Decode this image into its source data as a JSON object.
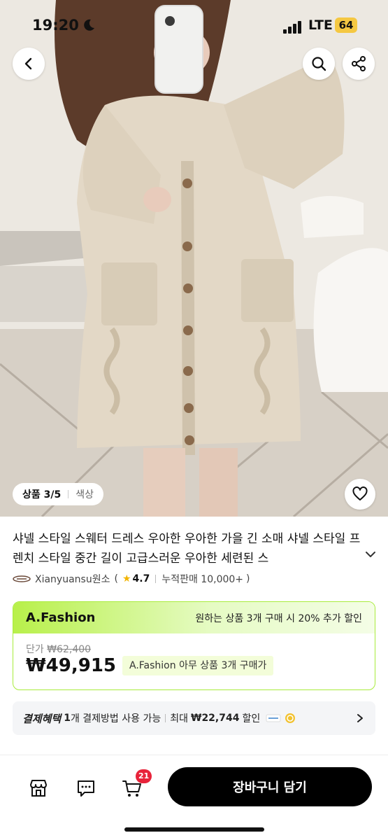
{
  "status_bar": {
    "time": "19:20",
    "network": "LTE",
    "battery": "64",
    "battery_color": "#f5c842"
  },
  "hero": {
    "icons": {
      "back": "chevron-left-icon",
      "search": "search-icon",
      "share": "share-icon",
      "wishlist": "heart-icon"
    },
    "pager": {
      "index": "상품 3/5",
      "tab": "색상"
    }
  },
  "product": {
    "title": "샤넬 스타일 스웨터 드레스 우아한 우아한 가을 긴 소매 샤넬 스타일 프렌치 스타일 중간 길이 고급스러운 우아한 세련된 스",
    "seller": {
      "name": "Xianyuansu원소",
      "open_paren": "(",
      "rating": "4.7",
      "sales": "누적판매 10,000+",
      "close_paren": ")"
    }
  },
  "promo": {
    "brand": "A.Fashion",
    "offer": "원하는 상품 3개 구매 시 20% 추가 할인",
    "unit_label": "단가",
    "unit_price": "₩62,400",
    "sale_price": "₩49,915",
    "tag": "A.Fashion 아무 상품 3개 구매가",
    "accent_color": "#a8ec3b"
  },
  "benefit": {
    "label": "결제혜택",
    "count": "1",
    "count_text": "개 결제방법 사용 가능",
    "max_label": "최대",
    "max_amount": "₩22,744",
    "discount_text": "할인"
  },
  "bottom_bar": {
    "cart_count": "21",
    "cart_button": "장바구니 담기",
    "icons": [
      "store-icon",
      "chat-icon",
      "cart-icon"
    ]
  }
}
